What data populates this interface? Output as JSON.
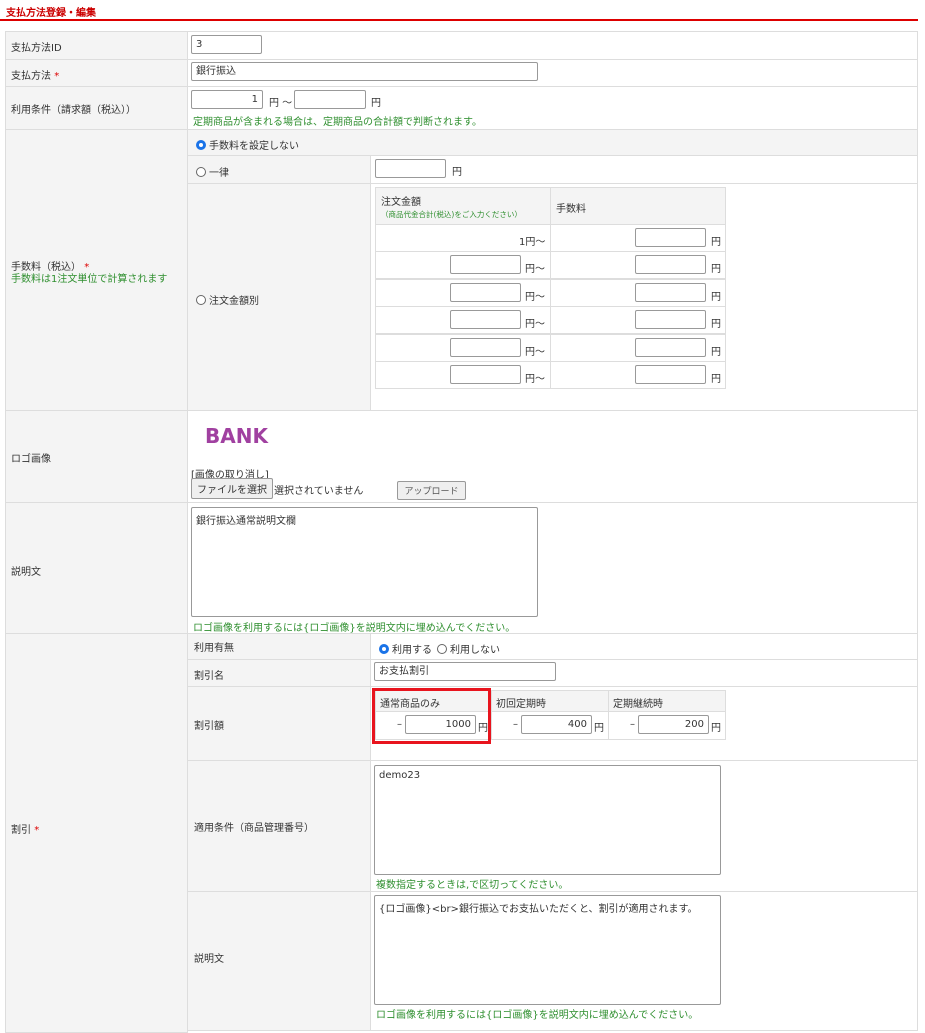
{
  "page_title": "支払方法登録・編集",
  "rows": {
    "id": {
      "label": "支払方法ID",
      "value": "3"
    },
    "method": {
      "label": "支払方法",
      "required": "*",
      "value": "銀行振込"
    },
    "usage": {
      "label": "利用条件（請求額（税込））",
      "min": "1",
      "max": "",
      "unit": "円",
      "tilde": "円 〜",
      "note": "定期商品が含まれる場合は、定期商品の合計額で判断されます。"
    },
    "fee": {
      "label": "手数料（税込）",
      "required": "*",
      "sublabel": "手数料は1注文単位で計算されます",
      "opt_none": "手数料を設定しない",
      "opt_flat": "一律",
      "flat_unit": "円",
      "opt_by_amount": "注文金額別",
      "col_amount": "注文金額",
      "col_amount_note": "（商品代金合計(税込)をご入力ください）",
      "col_fee": "手数料",
      "first_from": "1円〜",
      "from_unit": "円〜",
      "fee_unit": "円",
      "selected": "none"
    },
    "logo": {
      "label": "ロゴ画像",
      "logo_text": "BANK",
      "logo_color": "#a040a0",
      "cancel": "[画像の取り消し]",
      "choose_file": "ファイルを選択",
      "no_file": "選択されていません",
      "upload": "アップロード"
    },
    "description": {
      "label": "説明文",
      "value": "銀行振込通常説明文欄",
      "note": "ロゴ画像を利用するには{ロゴ画像}を説明文内に埋め込んでください。"
    },
    "discount": {
      "label": "割引",
      "required": "*",
      "use_label": "利用有無",
      "use_yes": "利用する",
      "use_no": "利用しない",
      "use_selected": "yes",
      "name_label": "割引名",
      "name_value": "お支払割引",
      "amount_label": "割引額",
      "minus": "–",
      "unit": "円",
      "cols": [
        {
          "header": "通常商品のみ",
          "value": "1000"
        },
        {
          "header": "初回定期時",
          "value": "400"
        },
        {
          "header": "定期継続時",
          "value": "200"
        }
      ],
      "cond_label": "適用条件（商品管理番号）",
      "cond_value": "demo23",
      "cond_note": "複数指定するときは,で区切ってください。",
      "desc_label": "説明文",
      "desc_value": "{ロゴ画像}<br>銀行振込でお支払いただくと、割引が適用されます。",
      "desc_note": "ロゴ画像を利用するには{ロゴ画像}を説明文内に埋め込んでください。",
      "highlight_color": "#e8141e"
    }
  }
}
